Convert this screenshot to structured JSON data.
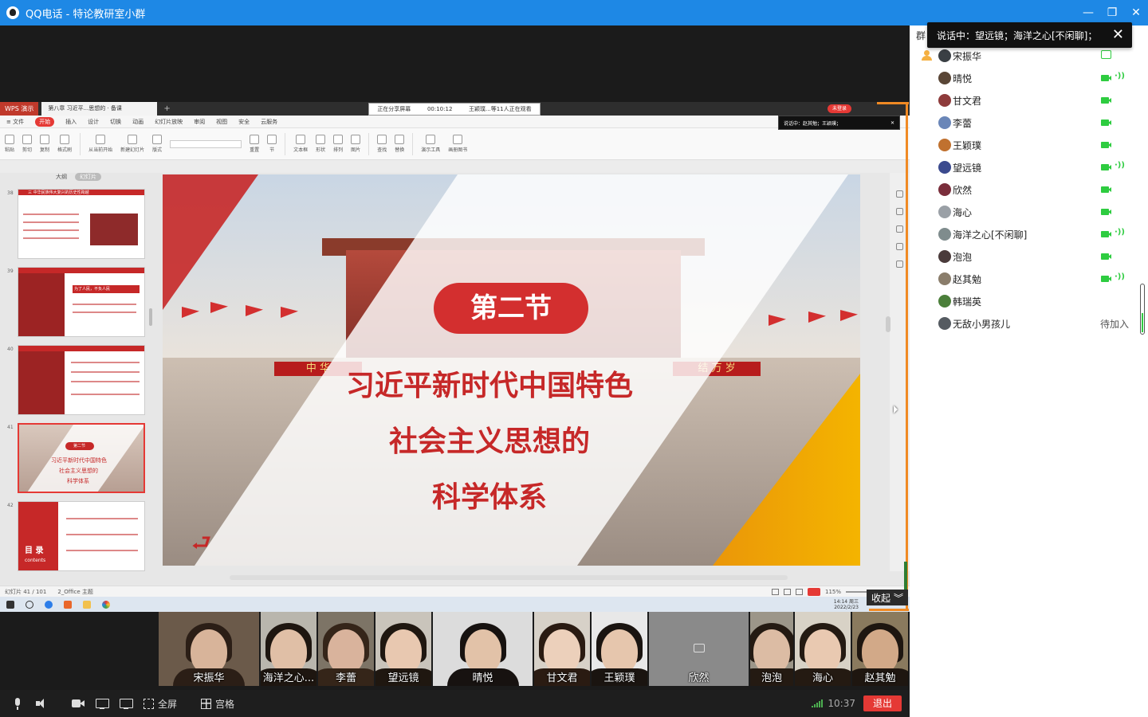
{
  "window": {
    "title": "QQ电话 - 特论教研室小群",
    "controls": [
      "—",
      "❐",
      "✕"
    ]
  },
  "talking_popup": {
    "text": "说话中：望远镜；海洋之心[不闲聊]；",
    "close": "✕"
  },
  "panel": {
    "tab": "群",
    "members": [
      {
        "name": "宋振华",
        "host": true,
        "status": "sharing",
        "color": "#3a3f44"
      },
      {
        "name": "晴悦",
        "status": "cam-talking",
        "color": "#5a4636"
      },
      {
        "name": "甘文君",
        "status": "cam",
        "color": "#8e3b3b"
      },
      {
        "name": "李蕾",
        "status": "cam",
        "color": "#6a86b8"
      },
      {
        "name": "王颖璞",
        "status": "cam",
        "color": "#c0712f"
      },
      {
        "name": "望远镜",
        "status": "cam-talking",
        "color": "#3b4a8e"
      },
      {
        "name": "欣然",
        "status": "cam",
        "color": "#7a2e3b"
      },
      {
        "name": "海心",
        "status": "cam",
        "color": "#9aa0a6"
      },
      {
        "name": "海洋之心[不闲聊]",
        "status": "cam-talking",
        "color": "#7f8c8d"
      },
      {
        "name": "泡泡",
        "status": "cam",
        "color": "#4a3b3b"
      },
      {
        "name": "赵其勉",
        "status": "cam-talking",
        "color": "#8a7d6b"
      },
      {
        "name": "韩瑞英",
        "status": "none",
        "color": "#4b7f3a"
      },
      {
        "name": "无敌小男孩儿",
        "status": "pending",
        "color": "#555b61"
      }
    ],
    "pending_label": "待加入",
    "wave": "·))"
  },
  "wps": {
    "logo": "WPS 演示",
    "doc_tab": "第八章 习近平...思想的 · 备课",
    "plus": "+",
    "share_banner": {
      "label": "正在分享屏幕",
      "time": "00:10:12",
      "info": "王颖璞...等11人正在观看"
    },
    "red_pill": "未登录",
    "talking_mini": "说话中：赵其勉；王颖璞；",
    "menu": [
      "≡ 文件",
      "开始",
      "插入",
      "设计",
      "切换",
      "动画",
      "幻灯片放映",
      "审阅",
      "视图",
      "安全",
      "云服务"
    ],
    "active_menu": "开始",
    "ribbon": [
      "粘贴",
      "剪切",
      "复制",
      "格式刷",
      "从当前开始",
      "新建幻灯片",
      "版式",
      "重置",
      "节",
      "文本框",
      "形状",
      "排列",
      "图片",
      "查找",
      "替换",
      "演示工具",
      "画册图书"
    ],
    "thumb_head": {
      "outline": "大纲",
      "slides": "幻灯片"
    },
    "thumb_numbers": [
      "38",
      "39",
      "40",
      "41",
      "42"
    ],
    "thumb_texts": {
      "t38": "三 中华民族伟大复兴的历史性跨越",
      "t39": "为了人民，不负人民",
      "t41_badge": "第二节",
      "t41_l1": "习近平新时代中国特色",
      "t41_l2": "社会主义思想的",
      "t41_l3": "科学体系",
      "t42": "目 录",
      "t42_sub": "contents"
    },
    "slide": {
      "badge": "第二节",
      "line1": "习近平新时代中国特色",
      "line2": "社会主义思想的",
      "line3": "科学体系",
      "banner_left": "中 华",
      "banner_right": "结 万 岁"
    },
    "status": {
      "slide": "幻灯片 41 / 101",
      "theme": "2_Office 主题",
      "zoom": "115%"
    },
    "taskbar_clock": {
      "time": "14:14 周三",
      "date": "2022/2/23"
    }
  },
  "collapse": {
    "label": "收起"
  },
  "videos": [
    {
      "name": "宋振华",
      "bg": "#6b5a4a",
      "skin": "#d8b49a",
      "hair": "#2b1e16",
      "width": 126
    },
    {
      "name": "海洋之心...",
      "bg": "#b9b6ad",
      "skin": "#e0bfa6",
      "hair": "#1e1610",
      "width": 70
    },
    {
      "name": "李蕾",
      "bg": "#7d7466",
      "skin": "#d9b39c",
      "hair": "#352519",
      "width": 70
    },
    {
      "name": "望远镜",
      "bg": "#c9c4bb",
      "skin": "#e8c8b0",
      "hair": "#1f1710",
      "width": 70
    },
    {
      "name": "晴悦",
      "bg": "#dcdcdc",
      "skin": "#e2c2a8",
      "hair": "#171210",
      "width": 125
    },
    {
      "name": "甘文君",
      "bg": "#d7d1c8",
      "skin": "#ecd0bb",
      "hair": "#2a1b12",
      "width": 70
    },
    {
      "name": "王颖璞",
      "bg": "#e8e8e8",
      "skin": "#e6c6ad",
      "hair": "#1a1410",
      "width": 70
    },
    {
      "name": "欣然",
      "bg": "#8a8a8a",
      "camoff": true,
      "width": 125
    },
    {
      "name": "泡泡",
      "bg": "#9c9689",
      "skin": "#dcbca4",
      "hair": "#241a12",
      "width": 54
    },
    {
      "name": "海心",
      "bg": "#d8d2c6",
      "skin": "#e9c9b1",
      "hair": "#241a12",
      "width": 70
    },
    {
      "name": "赵其勉",
      "bg": "#8a7a5e",
      "skin": "#d2a988",
      "hair": "#1e1610",
      "width": 70
    }
  ],
  "toolbar": {
    "fullscreen": "全屏",
    "grid": "宫格",
    "clock": "10:37",
    "exit": "退出"
  }
}
